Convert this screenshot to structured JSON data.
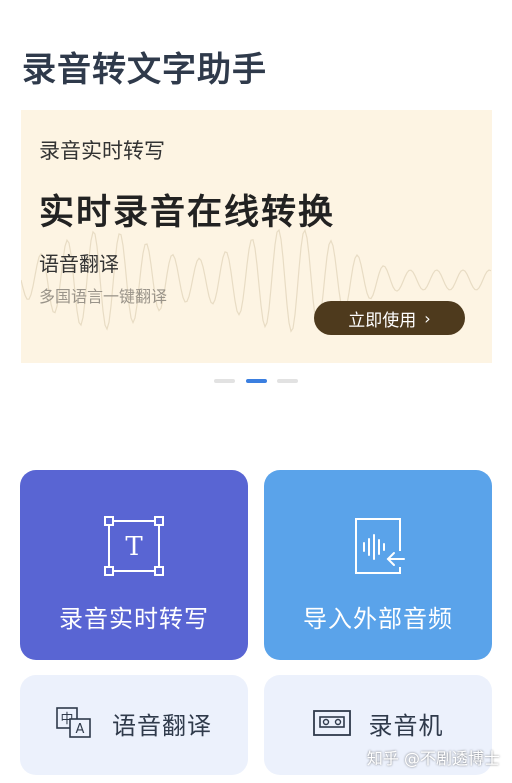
{
  "app": {
    "title": "录音转文字助手"
  },
  "banner": {
    "subtitle": "录音实时转写",
    "headline": "实时录音在线转换",
    "feature": "语音翻译",
    "feature_desc": "多国语言一键翻译",
    "cta_label": "立即使用",
    "cta_icon": "chevron-right-icon",
    "background_color": "#fdf4e3"
  },
  "carousel": {
    "page_count": 3,
    "active_index": 1,
    "active_color": "#3b7fe0"
  },
  "cards": [
    {
      "label": "录音实时转写",
      "icon": "text-frame-icon",
      "color": "#5965d3"
    },
    {
      "label": "导入外部音频",
      "icon": "audio-import-icon",
      "color": "#5aa3ea"
    },
    {
      "label": "语音翻译",
      "icon": "translate-icon",
      "color": "#ecf1fc"
    },
    {
      "label": "录音机",
      "icon": "cassette-icon",
      "color": "#ecf1fc"
    }
  ],
  "watermark": "知乎 @不剧透博士"
}
